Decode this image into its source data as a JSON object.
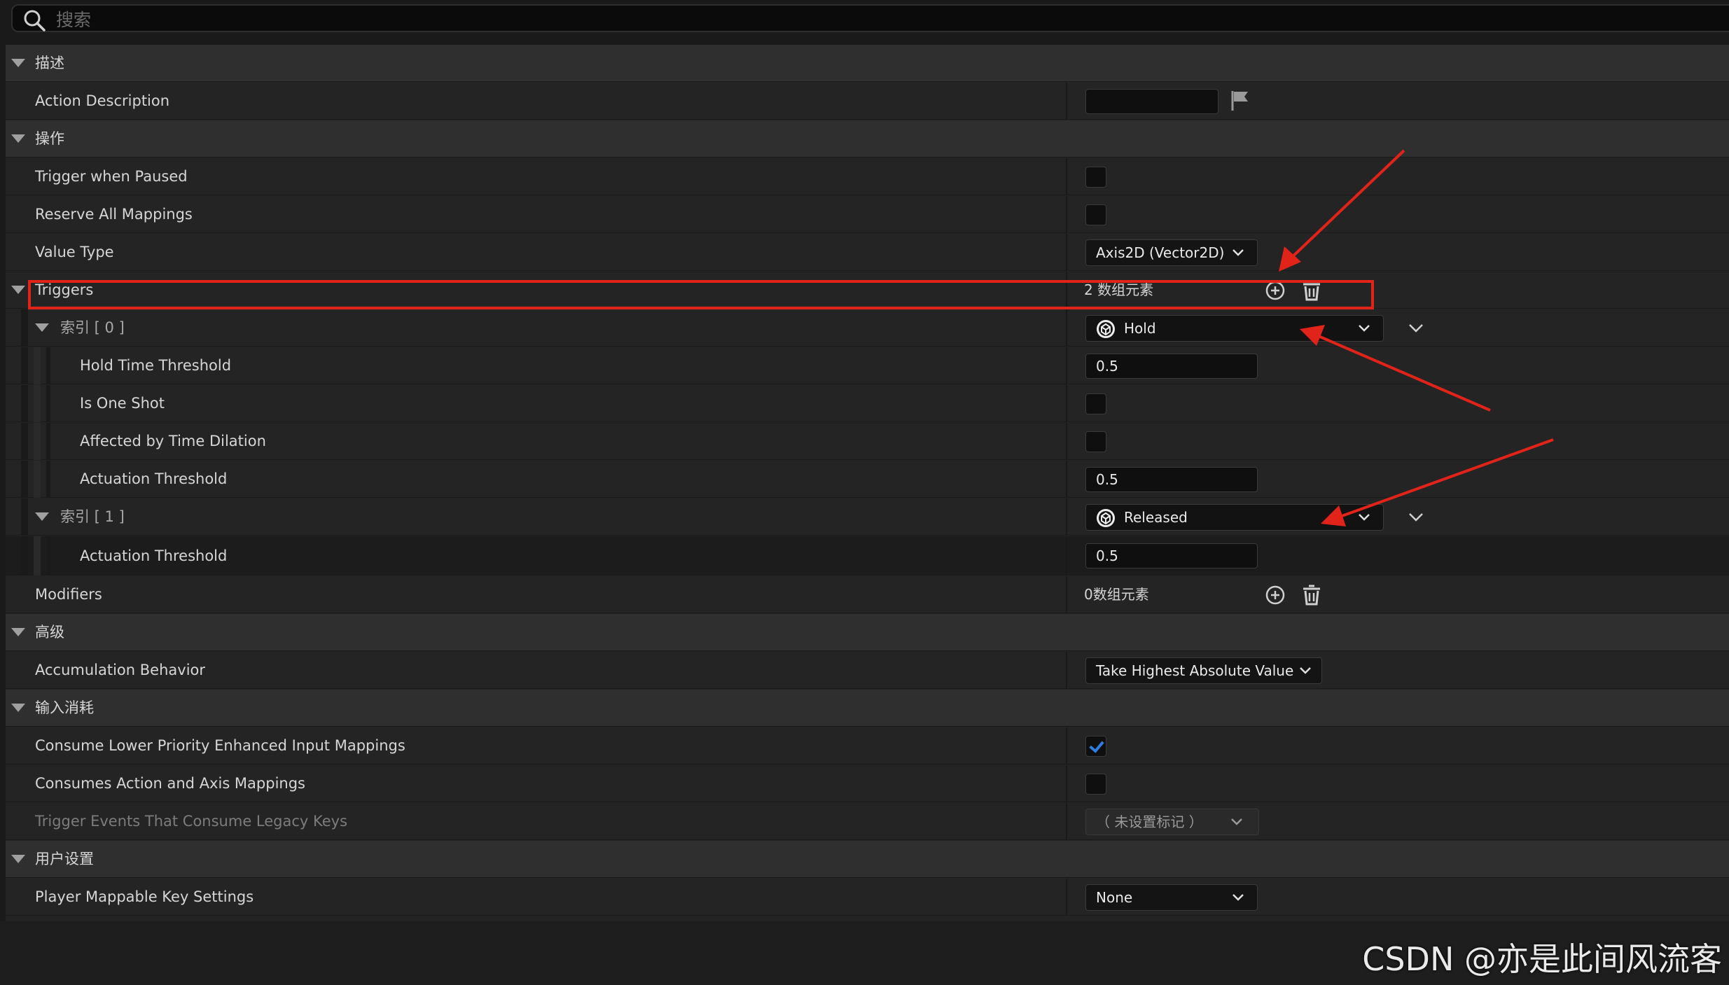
{
  "search": {
    "placeholder": "搜索"
  },
  "sections": {
    "description": {
      "title": "描述",
      "action_description": {
        "label": "Action Description",
        "value": ""
      }
    },
    "action": {
      "title": "操作",
      "trigger_when_paused": {
        "label": "Trigger when Paused",
        "checked": false
      },
      "reserve_all_mappings": {
        "label": "Reserve All Mappings",
        "checked": false
      },
      "value_type": {
        "label": "Value Type",
        "value": "Axis2D (Vector2D)"
      },
      "triggers": {
        "label": "Triggers",
        "count": "2 数组元素",
        "index0": {
          "label": "索引 [ 0 ]",
          "type": "Hold",
          "hold_time_threshold": {
            "label": "Hold Time Threshold",
            "value": "0.5"
          },
          "is_one_shot": {
            "label": "Is One Shot",
            "checked": false
          },
          "affected_by_time_dilation": {
            "label": "Affected by Time Dilation",
            "checked": false
          },
          "actuation_threshold": {
            "label": "Actuation Threshold",
            "value": "0.5"
          }
        },
        "index1": {
          "label": "索引 [ 1 ]",
          "type": "Released",
          "actuation_threshold": {
            "label": "Actuation Threshold",
            "value": "0.5"
          }
        }
      },
      "modifiers": {
        "label": "Modifiers",
        "count": "0数组元素"
      }
    },
    "advanced": {
      "title": "高级",
      "accumulation_behavior": {
        "label": "Accumulation Behavior",
        "value": "Take Highest Absolute Value"
      }
    },
    "input_consumption": {
      "title": "输入消耗",
      "consume_lower_priority": {
        "label": "Consume Lower Priority Enhanced Input Mappings",
        "checked": true
      },
      "consumes_action_axis": {
        "label": "Consumes Action and Axis Mappings",
        "checked": false
      },
      "trigger_events_legacy": {
        "label": "Trigger Events That Consume Legacy Keys",
        "value": "（ 未设置标记 ）"
      }
    },
    "user_settings": {
      "title": "用户设置",
      "player_mappable": {
        "label": "Player Mappable Key Settings",
        "value": "None"
      }
    }
  },
  "watermark": "CSDN @亦是此间风流客",
  "colors": {
    "background": "#1a1a1a",
    "row": "#242424",
    "category": "#2f2f2f",
    "accent_check": "#2f7de1",
    "annotation": "#e2231a"
  }
}
